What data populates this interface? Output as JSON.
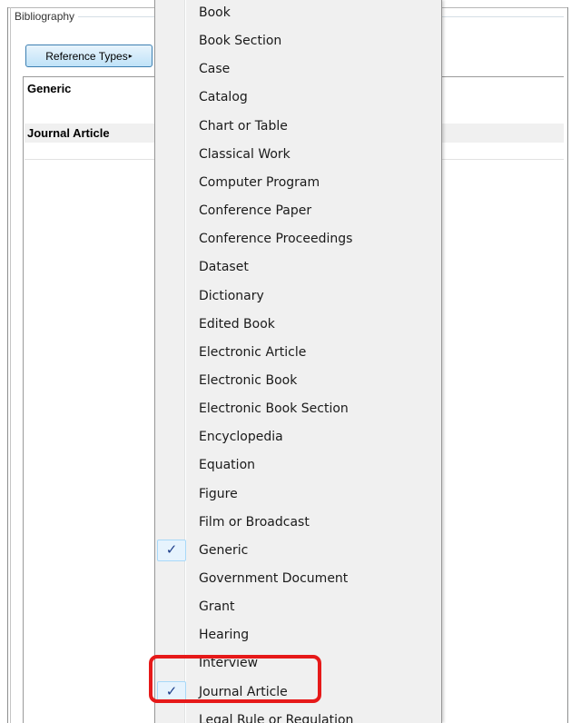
{
  "window": {
    "group_title": "Bibliography",
    "reference_types_button": "Reference Types",
    "arrow_glyph": "▸"
  },
  "list": {
    "rows": [
      "Generic",
      "Journal Article"
    ]
  },
  "menu": {
    "check_glyph": "✓",
    "items": [
      {
        "label": "Book",
        "checked": false
      },
      {
        "label": "Book Section",
        "checked": false
      },
      {
        "label": "Case",
        "checked": false
      },
      {
        "label": "Catalog",
        "checked": false
      },
      {
        "label": "Chart or Table",
        "checked": false
      },
      {
        "label": "Classical Work",
        "checked": false
      },
      {
        "label": "Computer Program",
        "checked": false
      },
      {
        "label": "Conference Paper",
        "checked": false
      },
      {
        "label": "Conference Proceedings",
        "checked": false
      },
      {
        "label": "Dataset",
        "checked": false
      },
      {
        "label": "Dictionary",
        "checked": false
      },
      {
        "label": "Edited Book",
        "checked": false
      },
      {
        "label": "Electronic Article",
        "checked": false
      },
      {
        "label": "Electronic Book",
        "checked": false
      },
      {
        "label": "Electronic Book Section",
        "checked": false
      },
      {
        "label": "Encyclopedia",
        "checked": false
      },
      {
        "label": "Equation",
        "checked": false
      },
      {
        "label": "Figure",
        "checked": false
      },
      {
        "label": "Film or Broadcast",
        "checked": false
      },
      {
        "label": "Generic",
        "checked": true
      },
      {
        "label": "Government Document",
        "checked": false
      },
      {
        "label": "Grant",
        "checked": false
      },
      {
        "label": "Hearing",
        "checked": false
      },
      {
        "label": "Interview",
        "checked": false
      },
      {
        "label": "Journal Article",
        "checked": true
      },
      {
        "label": "Legal Rule or Regulation",
        "checked": false
      }
    ]
  },
  "colors": {
    "highlight": "#e61919",
    "button_border": "#3c7fb1",
    "check": "#1e3f8a"
  }
}
